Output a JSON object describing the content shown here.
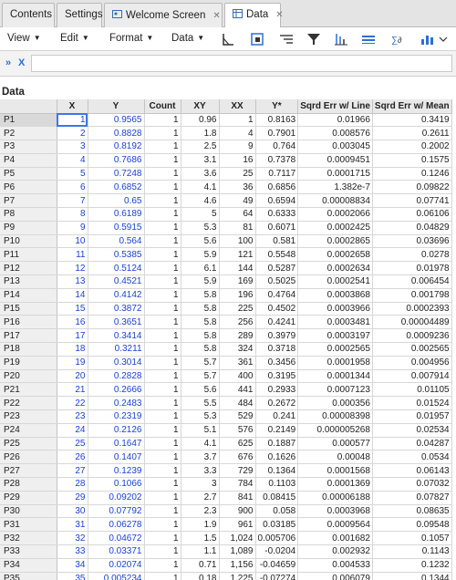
{
  "tabs": [
    {
      "label": "Contents",
      "active": false
    },
    {
      "label": "Settings",
      "active": false
    },
    {
      "label": "Welcome Screen",
      "active": false,
      "closable": true,
      "icon": "welcome-icon"
    },
    {
      "label": "Data",
      "active": true,
      "closable": true,
      "icon": "table-icon"
    }
  ],
  "toolbar": {
    "menus": [
      "View",
      "Edit",
      "Format",
      "Data"
    ],
    "icons": [
      "chart-triangle-icon",
      "frame-icon",
      "align-right-icon",
      "filter-icon",
      "sort-icon",
      "columns-icon",
      "formula-icon",
      "chart-bar-icon"
    ]
  },
  "formula_bar": {
    "label": "X",
    "value": ""
  },
  "sheet": {
    "title": "Data",
    "columns": [
      "X",
      "Y",
      "Count",
      "XY",
      "XX",
      "Y*",
      "Sqrd Err w/ Line",
      "Sqrd Err w/ Mean"
    ],
    "rows": [
      {
        "id": "P1",
        "cells": [
          "1",
          "0.9565",
          "1",
          "0.96",
          "1",
          "0.8163",
          "0.01966",
          "0.3419"
        ]
      },
      {
        "id": "P2",
        "cells": [
          "2",
          "0.8828",
          "1",
          "1.8",
          "4",
          "0.7901",
          "0.008576",
          "0.2611"
        ]
      },
      {
        "id": "P3",
        "cells": [
          "3",
          "0.8192",
          "1",
          "2.5",
          "9",
          "0.764",
          "0.003045",
          "0.2002"
        ]
      },
      {
        "id": "P4",
        "cells": [
          "4",
          "0.7686",
          "1",
          "3.1",
          "16",
          "0.7378",
          "0.0009451",
          "0.1575"
        ]
      },
      {
        "id": "P5",
        "cells": [
          "5",
          "0.7248",
          "1",
          "3.6",
          "25",
          "0.7117",
          "0.0001715",
          "0.1246"
        ]
      },
      {
        "id": "P6",
        "cells": [
          "6",
          "0.6852",
          "1",
          "4.1",
          "36",
          "0.6856",
          "1.382e-7",
          "0.09822"
        ]
      },
      {
        "id": "P7",
        "cells": [
          "7",
          "0.65",
          "1",
          "4.6",
          "49",
          "0.6594",
          "0.00008834",
          "0.07741"
        ]
      },
      {
        "id": "P8",
        "cells": [
          "8",
          "0.6189",
          "1",
          "5",
          "64",
          "0.6333",
          "0.0002066",
          "0.06106"
        ]
      },
      {
        "id": "P9",
        "cells": [
          "9",
          "0.5915",
          "1",
          "5.3",
          "81",
          "0.6071",
          "0.0002425",
          "0.04829"
        ]
      },
      {
        "id": "P10",
        "cells": [
          "10",
          "0.564",
          "1",
          "5.6",
          "100",
          "0.581",
          "0.0002865",
          "0.03696"
        ]
      },
      {
        "id": "P11",
        "cells": [
          "11",
          "0.5385",
          "1",
          "5.9",
          "121",
          "0.5548",
          "0.0002658",
          "0.0278"
        ]
      },
      {
        "id": "P12",
        "cells": [
          "12",
          "0.5124",
          "1",
          "6.1",
          "144",
          "0.5287",
          "0.0002634",
          "0.01978"
        ]
      },
      {
        "id": "P13",
        "cells": [
          "13",
          "0.4521",
          "1",
          "5.9",
          "169",
          "0.5025",
          "0.0002541",
          "0.006454"
        ]
      },
      {
        "id": "P14",
        "cells": [
          "14",
          "0.4142",
          "1",
          "5.8",
          "196",
          "0.4764",
          "0.0003868",
          "0.001798"
        ]
      },
      {
        "id": "P15",
        "cells": [
          "15",
          "0.3872",
          "1",
          "5.8",
          "225",
          "0.4502",
          "0.0003966",
          "0.0002393"
        ]
      },
      {
        "id": "P16",
        "cells": [
          "16",
          "0.3651",
          "1",
          "5.8",
          "256",
          "0.4241",
          "0.0003481",
          "0.00004489"
        ]
      },
      {
        "id": "P17",
        "cells": [
          "17",
          "0.3414",
          "1",
          "5.8",
          "289",
          "0.3979",
          "0.0003197",
          "0.0009236"
        ]
      },
      {
        "id": "P18",
        "cells": [
          "18",
          "0.3211",
          "1",
          "5.8",
          "324",
          "0.3718",
          "0.0002565",
          "0.002565"
        ]
      },
      {
        "id": "P19",
        "cells": [
          "19",
          "0.3014",
          "1",
          "5.7",
          "361",
          "0.3456",
          "0.0001958",
          "0.004956"
        ]
      },
      {
        "id": "P20",
        "cells": [
          "20",
          "0.2828",
          "1",
          "5.7",
          "400",
          "0.3195",
          "0.0001344",
          "0.007914"
        ]
      },
      {
        "id": "P21",
        "cells": [
          "21",
          "0.2666",
          "1",
          "5.6",
          "441",
          "0.2933",
          "0.0007123",
          "0.01105"
        ]
      },
      {
        "id": "P22",
        "cells": [
          "22",
          "0.2483",
          "1",
          "5.5",
          "484",
          "0.2672",
          "0.000356",
          "0.01524"
        ]
      },
      {
        "id": "P23",
        "cells": [
          "23",
          "0.2319",
          "1",
          "5.3",
          "529",
          "0.241",
          "0.00008398",
          "0.01957"
        ]
      },
      {
        "id": "P24",
        "cells": [
          "24",
          "0.2126",
          "1",
          "5.1",
          "576",
          "0.2149",
          "0.000005268",
          "0.02534"
        ]
      },
      {
        "id": "P25",
        "cells": [
          "25",
          "0.1647",
          "1",
          "4.1",
          "625",
          "0.1887",
          "0.000577",
          "0.04287"
        ]
      },
      {
        "id": "P26",
        "cells": [
          "26",
          "0.1407",
          "1",
          "3.7",
          "676",
          "0.1626",
          "0.00048",
          "0.0534"
        ]
      },
      {
        "id": "P27",
        "cells": [
          "27",
          "0.1239",
          "1",
          "3.3",
          "729",
          "0.1364",
          "0.0001568",
          "0.06143"
        ]
      },
      {
        "id": "P28",
        "cells": [
          "28",
          "0.1066",
          "1",
          "3",
          "784",
          "0.1103",
          "0.0001369",
          "0.07032"
        ]
      },
      {
        "id": "P29",
        "cells": [
          "29",
          "0.09202",
          "1",
          "2.7",
          "841",
          "0.08415",
          "0.00006188",
          "0.07827"
        ]
      },
      {
        "id": "P30",
        "cells": [
          "30",
          "0.07792",
          "1",
          "2.3",
          "900",
          "0.058",
          "0.0003968",
          "0.08635"
        ]
      },
      {
        "id": "P31",
        "cells": [
          "31",
          "0.06278",
          "1",
          "1.9",
          "961",
          "0.03185",
          "0.0009564",
          "0.09548"
        ]
      },
      {
        "id": "P32",
        "cells": [
          "32",
          "0.04672",
          "1",
          "1.5",
          "1,024",
          "0.005706",
          "0.001682",
          "0.1057"
        ]
      },
      {
        "id": "P33",
        "cells": [
          "33",
          "0.03371",
          "1",
          "1.1",
          "1,089",
          "-0.0204",
          "0.002932",
          "0.1143"
        ]
      },
      {
        "id": "P34",
        "cells": [
          "34",
          "0.02074",
          "1",
          "0.71",
          "1,156",
          "-0.04659",
          "0.004533",
          "0.1232"
        ]
      },
      {
        "id": "P35",
        "cells": [
          "35",
          "0.005234",
          "1",
          "0.18",
          "1,225",
          "-0.07274",
          "0.006079",
          "0.1344"
        ]
      }
    ]
  },
  "colors": {
    "accent_blue": "#1a3fd6",
    "selection": "#3b78e7",
    "header_bg": "#e9e9e9"
  }
}
